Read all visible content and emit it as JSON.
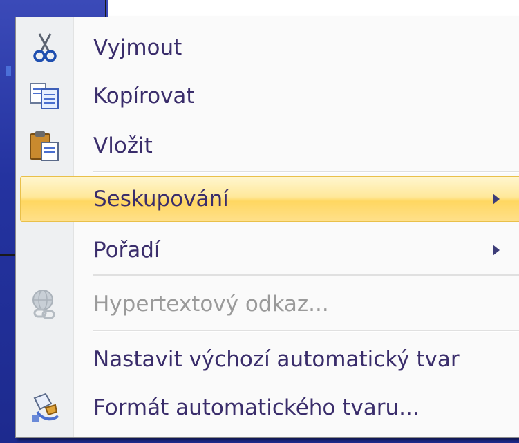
{
  "context_menu": {
    "items": [
      {
        "label": "Vyjmout",
        "icon": "scissors-icon",
        "enabled": true,
        "submenu": false
      },
      {
        "label": "Kopírovat",
        "icon": "copy-icon",
        "enabled": true,
        "submenu": false
      },
      {
        "label": "Vložit",
        "icon": "paste-icon",
        "enabled": true,
        "submenu": false
      },
      {
        "label": "Seskupování",
        "icon": "",
        "enabled": true,
        "submenu": true,
        "highlighted": true
      },
      {
        "label": "Pořadí",
        "icon": "",
        "enabled": true,
        "submenu": true
      },
      {
        "label": "Hypertextový odkaz...",
        "icon": "hyperlink-icon",
        "enabled": false,
        "submenu": false
      },
      {
        "label": "Nastavit výchozí automatický tvar",
        "icon": "",
        "enabled": true,
        "submenu": false
      },
      {
        "label": "Formát automatického tvaru...",
        "icon": "format-shape-icon",
        "enabled": true,
        "submenu": false
      }
    ]
  },
  "colors": {
    "menu_text": "#3a2d6b",
    "disabled_text": "#9a9a9a",
    "highlight": "#ffd761",
    "background": "#2a3a9c"
  }
}
